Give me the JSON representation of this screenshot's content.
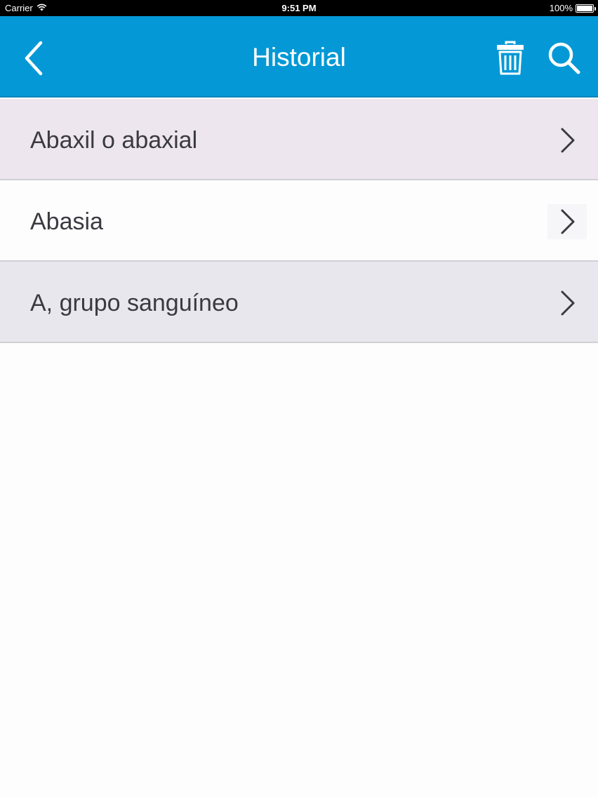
{
  "status_bar": {
    "carrier": "Carrier",
    "time": "9:51 PM",
    "battery": "100%"
  },
  "nav": {
    "title": "Historial",
    "back_icon": "chevron-left-icon",
    "trash_icon": "trash-icon",
    "search_icon": "search-icon",
    "color": "#0499d6"
  },
  "history": {
    "items": [
      {
        "label": "Abaxil o abaxial",
        "bg": "#ede6ee"
      },
      {
        "label": "Abasia",
        "bg": "#fdfdfe"
      },
      {
        "label": "A, grupo sanguíneo",
        "bg": "#e9e7ee"
      }
    ]
  }
}
